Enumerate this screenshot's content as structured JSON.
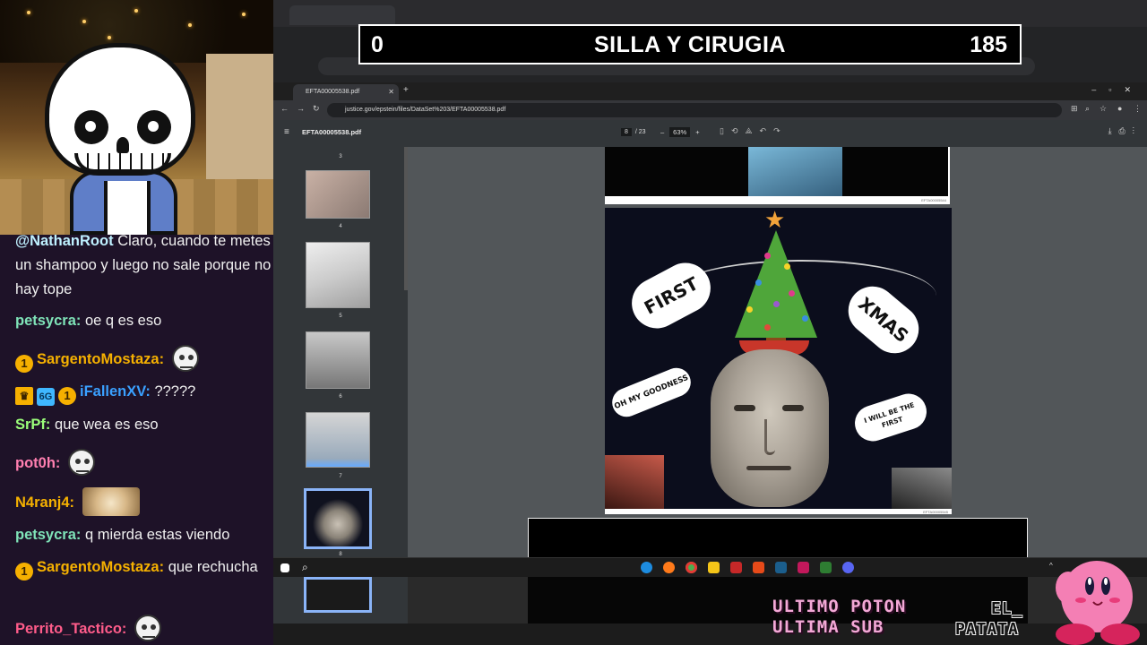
{
  "banner": {
    "left_number": "0",
    "title": "SILLA Y CIRUGIA",
    "right_number": "185"
  },
  "chat": [
    {
      "user": "@NathanRoot",
      "color": "#bff0ff",
      "text": "Claro, cuando te metes un shampoo y luego no sale porque no hay tope",
      "badges": [],
      "emote": ""
    },
    {
      "user": "petsycra:",
      "color": "#7fe3b8",
      "text": "oe q es eso",
      "badges": [],
      "emote": ""
    },
    {
      "user": "SargentoMostaza:",
      "color": "#f6b100",
      "text": "",
      "badges": [
        "1"
      ],
      "emote": "face"
    },
    {
      "user": "iFallenXV:",
      "color": "#3aa0ff",
      "text": "?????",
      "badges": [
        "crown",
        "6G",
        "1"
      ],
      "emote": ""
    },
    {
      "user": "SrPf:",
      "color": "#9bff7a",
      "text": "que wea es eso",
      "badges": [],
      "emote": ""
    },
    {
      "user": "pot0h:",
      "color": "#ff7fb0",
      "text": "",
      "badges": [],
      "emote": "face"
    },
    {
      "user": "N4ranj4:",
      "color": "#f6b100",
      "text": "",
      "badges": [],
      "emote": "cat"
    },
    {
      "user": "petsycra:",
      "color": "#7fe3b8",
      "text": "q mierda estas viendo",
      "badges": [],
      "emote": ""
    },
    {
      "user": "SargentoMostaza:",
      "color": "#f6b100",
      "text": "que rechucha",
      "badges": [
        "1"
      ],
      "emote": ""
    },
    {
      "user": "Perrito_Tactico:",
      "color": "#ff5c8a",
      "text": "",
      "badges": [],
      "emote": "face"
    }
  ],
  "browser": {
    "tab_title": "EFTA00005538.pdf",
    "url": "justice.gov/epstein/files/DataSet%203/EFTA00005538.pdf",
    "pdf_title": "EFTA00005538.pdf",
    "page_current": "8",
    "page_total": "/ 23",
    "zoom": "63%"
  },
  "thumbnails": [
    {
      "num": "3"
    },
    {
      "num": "4"
    },
    {
      "num": "5"
    },
    {
      "num": "6"
    },
    {
      "num": "7"
    },
    {
      "num": "8"
    }
  ],
  "pdf_page": {
    "footer_top": "EFTA00005544",
    "footer_main": "EFTA00005545",
    "cloud_first": "FIRST",
    "cloud_xmas": "XMAS",
    "cloud_goodness": "OH MY GOODNESS",
    "cloud_will": "I WILL BE THE FIRST"
  },
  "overlay": {
    "ultimo_line1": "ULTIMO POTON",
    "ultimo_line2": "ULTIMA SUB",
    "brand_line1": "EL_",
    "brand_line2": "PATATA"
  }
}
